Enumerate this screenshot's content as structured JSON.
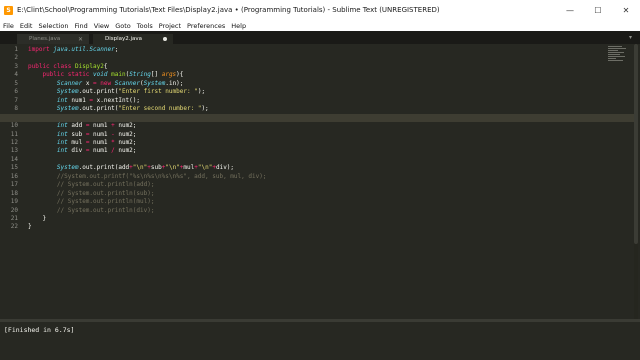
{
  "window": {
    "title": "E:\\Clint\\School\\Programming Tutorials\\Text Files\\Display2.java • (Programming Tutorials) - Sublime Text (UNREGISTERED)",
    "app_icon": "S",
    "minimize": "—",
    "maximize": "☐",
    "close": "✕"
  },
  "menu": [
    "File",
    "Edit",
    "Selection",
    "Find",
    "View",
    "Goto",
    "Tools",
    "Project",
    "Preferences",
    "Help"
  ],
  "tabs": [
    {
      "label": "Planes.java",
      "close": "✕",
      "active": false
    },
    {
      "label": "Display2.java",
      "close": "",
      "active": true
    }
  ],
  "tab_menu_arrow": "▾",
  "editor": {
    "current_line": 9,
    "lines": [
      {
        "n": "1",
        "indent": "",
        "tokens": [
          [
            "kw",
            "import "
          ],
          [
            "ty",
            "java.util.Scanner"
          ],
          [
            "",
            "; "
          ]
        ]
      },
      {
        "n": "2",
        "indent": "",
        "tokens": []
      },
      {
        "n": "3",
        "indent": "",
        "tokens": [
          [
            "kw",
            "public "
          ],
          [
            "kw",
            "class "
          ],
          [
            "cl",
            "Display2"
          ],
          [
            "",
            "{"
          ]
        ]
      },
      {
        "n": "4",
        "indent": "    ",
        "tokens": [
          [
            "kw",
            "public "
          ],
          [
            "kw",
            "static "
          ],
          [
            "ty",
            "void "
          ],
          [
            "cl",
            "main"
          ],
          [
            "",
            "("
          ],
          [
            "ty",
            "String"
          ],
          [
            "",
            "[] "
          ],
          [
            "or",
            "args"
          ],
          [
            "",
            "){"
          ]
        ]
      },
      {
        "n": "5",
        "indent": "        ",
        "tokens": [
          [
            "ty",
            "Scanner "
          ],
          [
            "",
            "x "
          ],
          [
            "kw",
            "= new "
          ],
          [
            "ty",
            "Scanner"
          ],
          [
            "",
            "("
          ],
          [
            "ty",
            "System"
          ],
          [
            "",
            ".in);"
          ]
        ]
      },
      {
        "n": "6",
        "indent": "        ",
        "tokens": [
          [
            "ty",
            "System"
          ],
          [
            "",
            ".out.print("
          ],
          [
            "st",
            "\"Enter first number: \""
          ],
          [
            "",
            ");"
          ]
        ]
      },
      {
        "n": "7",
        "indent": "        ",
        "tokens": [
          [
            "ty",
            "int "
          ],
          [
            "",
            "num1 "
          ],
          [
            "kw",
            "= "
          ],
          [
            "",
            "x.nextInt();"
          ]
        ]
      },
      {
        "n": "8",
        "indent": "        ",
        "tokens": [
          [
            "ty",
            "System"
          ],
          [
            "",
            ".out.print("
          ],
          [
            "st",
            "\"Enter second number: \""
          ],
          [
            "",
            ");"
          ]
        ]
      },
      {
        "n": "9",
        "indent": "",
        "tokens": []
      },
      {
        "n": "10",
        "indent": "        ",
        "tokens": [
          [
            "ty",
            "int "
          ],
          [
            "",
            "add "
          ],
          [
            "kw",
            "= "
          ],
          [
            "",
            "num1 "
          ],
          [
            "kw",
            "+ "
          ],
          [
            "",
            "num2;"
          ]
        ]
      },
      {
        "n": "11",
        "indent": "        ",
        "tokens": [
          [
            "ty",
            "int "
          ],
          [
            "",
            "sub "
          ],
          [
            "kw",
            "= "
          ],
          [
            "",
            "num1 "
          ],
          [
            "kw",
            "- "
          ],
          [
            "",
            "num2;"
          ]
        ]
      },
      {
        "n": "12",
        "indent": "        ",
        "tokens": [
          [
            "ty",
            "int "
          ],
          [
            "",
            "mul "
          ],
          [
            "kw",
            "= "
          ],
          [
            "",
            "num1 "
          ],
          [
            "kw",
            "* "
          ],
          [
            "",
            "num2;"
          ]
        ]
      },
      {
        "n": "13",
        "indent": "        ",
        "tokens": [
          [
            "ty",
            "int "
          ],
          [
            "",
            "div "
          ],
          [
            "kw",
            "= "
          ],
          [
            "",
            "num1 "
          ],
          [
            "kw",
            "/ "
          ],
          [
            "",
            "num2;"
          ]
        ]
      },
      {
        "n": "14",
        "indent": "",
        "tokens": []
      },
      {
        "n": "15",
        "indent": "        ",
        "tokens": [
          [
            "ty",
            "System"
          ],
          [
            "",
            ".out.print(add"
          ],
          [
            "kw",
            "+"
          ],
          [
            "st",
            "\"\\n\""
          ],
          [
            "kw",
            "+"
          ],
          [
            "",
            "sub"
          ],
          [
            "kw",
            "+"
          ],
          [
            "st",
            "\"\\n\""
          ],
          [
            "kw",
            "+"
          ],
          [
            "",
            "mul"
          ],
          [
            "kw",
            "+"
          ],
          [
            "st",
            "\"\\n\""
          ],
          [
            "kw",
            "+"
          ],
          [
            "",
            "div);"
          ]
        ]
      },
      {
        "n": "16",
        "indent": "        ",
        "tokens": [
          [
            "cm",
            "//System.out.printf(\"%s\\n%s\\n%s\\n%s\", add, sub, mul, div);"
          ]
        ]
      },
      {
        "n": "17",
        "indent": "        ",
        "tokens": [
          [
            "cm",
            "// System.out.println(add);"
          ]
        ]
      },
      {
        "n": "18",
        "indent": "        ",
        "tokens": [
          [
            "cm",
            "// System.out.println(sub);"
          ]
        ]
      },
      {
        "n": "19",
        "indent": "        ",
        "tokens": [
          [
            "cm",
            "// System.out.println(mul);"
          ]
        ]
      },
      {
        "n": "20",
        "indent": "        ",
        "tokens": [
          [
            "cm",
            "// System.out.println(div);"
          ]
        ]
      },
      {
        "n": "21",
        "indent": "    ",
        "tokens": [
          [
            "",
            "}"
          ]
        ]
      },
      {
        "n": "22",
        "indent": "",
        "tokens": [
          [
            "",
            "}"
          ]
        ]
      }
    ]
  },
  "console": {
    "output": "[Finished in 6.7s]"
  },
  "colors": {
    "editor_bg": "#272822",
    "keyword": "#f92672",
    "type": "#66d9ef",
    "class_name": "#a6e22e",
    "string": "#e6db74",
    "comment": "#75715e",
    "param": "#fd971f"
  }
}
